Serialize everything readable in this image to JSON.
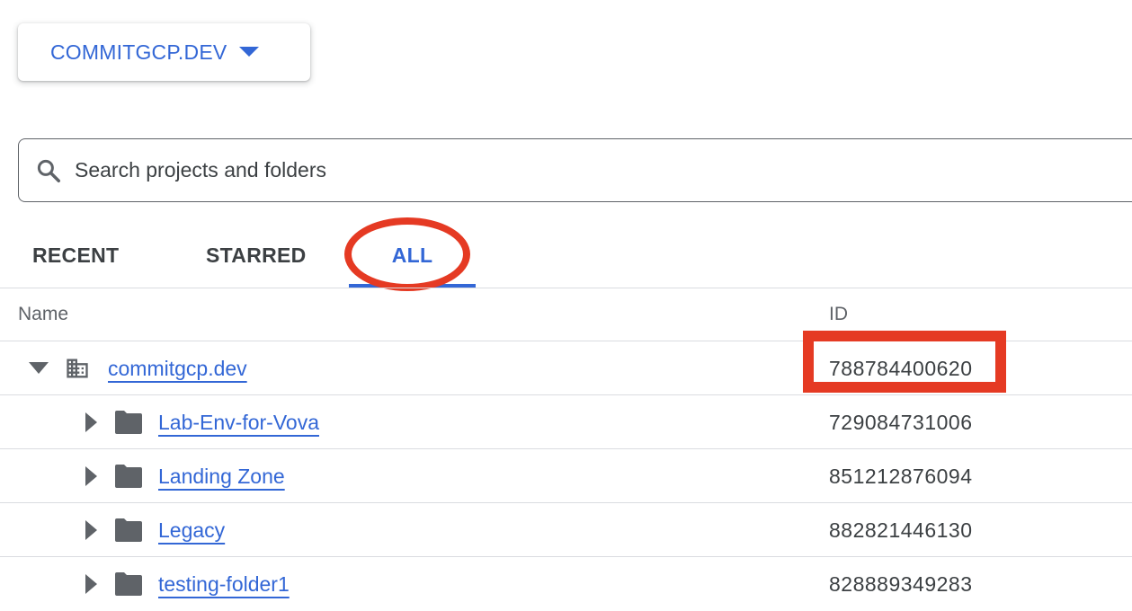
{
  "org_picker": {
    "label": "COMMITGCP.DEV"
  },
  "search": {
    "placeholder": "Search projects and folders",
    "value": ""
  },
  "tabs": [
    {
      "label": "RECENT",
      "active": false
    },
    {
      "label": "STARRED",
      "active": false
    },
    {
      "label": "ALL",
      "active": true
    }
  ],
  "table": {
    "columns": [
      "Name",
      "ID"
    ],
    "rows": [
      {
        "name": "commitgcp.dev",
        "id": "788784400620",
        "type": "organization",
        "expanded": true,
        "icon": "organization-icon"
      },
      {
        "name": "Lab-Env-for-Vova",
        "id": "729084731006",
        "type": "folder",
        "expanded": false,
        "icon": "folder-icon"
      },
      {
        "name": "Landing Zone",
        "id": "851212876094",
        "type": "folder",
        "expanded": false,
        "icon": "folder-icon"
      },
      {
        "name": "Legacy",
        "id": "882821446130",
        "type": "folder",
        "expanded": false,
        "icon": "folder-icon"
      },
      {
        "name": "testing-folder1",
        "id": "828889349283",
        "type": "folder",
        "expanded": false,
        "icon": "folder-icon"
      }
    ]
  },
  "colors": {
    "accent": "#3367d6",
    "annotation_red": "#e53a23",
    "text": "#3c4043",
    "muted": "#5f6368",
    "divider": "#dadce0"
  }
}
